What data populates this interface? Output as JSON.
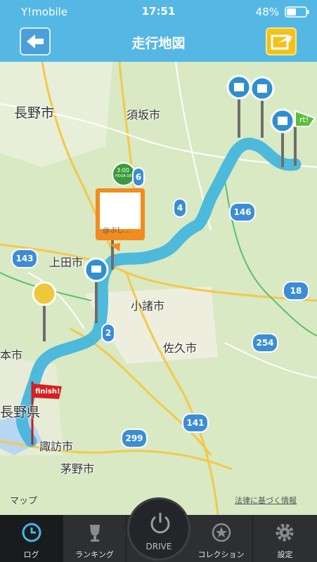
{
  "status": {
    "carrier": "Y!mobile",
    "time": "17:51",
    "battery": "48%"
  },
  "nav": {
    "title": "走行地図",
    "back_icon": "back-arrow-icon",
    "share_icon": "share-icon"
  },
  "map": {
    "labels": {
      "nagano": "長野市",
      "suzaka": "須坂市",
      "ueda": "上田市",
      "komoro": "小諸市",
      "saku": "佐久市",
      "suwa": "諏訪市",
      "chino": "茅野市",
      "nagano_ken": "長野県",
      "hon": "本市",
      "start_fragment": "rt!",
      "finish": "finish!",
      "clock_badge_time": "3:00",
      "clock_badge_text": "HOUR DRIVE",
      "photo_caption": "@ぶし…"
    },
    "routes": [
      "143",
      "146",
      "18",
      "254",
      "141",
      "299",
      "6",
      "4",
      "2"
    ],
    "apple_maps": "マップ",
    "legal": "法律に基づく情報"
  },
  "tabs": [
    {
      "label": "ログ",
      "icon": "clock-icon",
      "active": true
    },
    {
      "label": "ランキング",
      "icon": "trophy-icon",
      "active": false
    },
    {
      "label": "DRIVE",
      "icon": "power-icon",
      "active": false
    },
    {
      "label": "コレクション",
      "icon": "star-icon",
      "active": false
    },
    {
      "label": "設定",
      "icon": "gear-icon",
      "active": false
    }
  ]
}
